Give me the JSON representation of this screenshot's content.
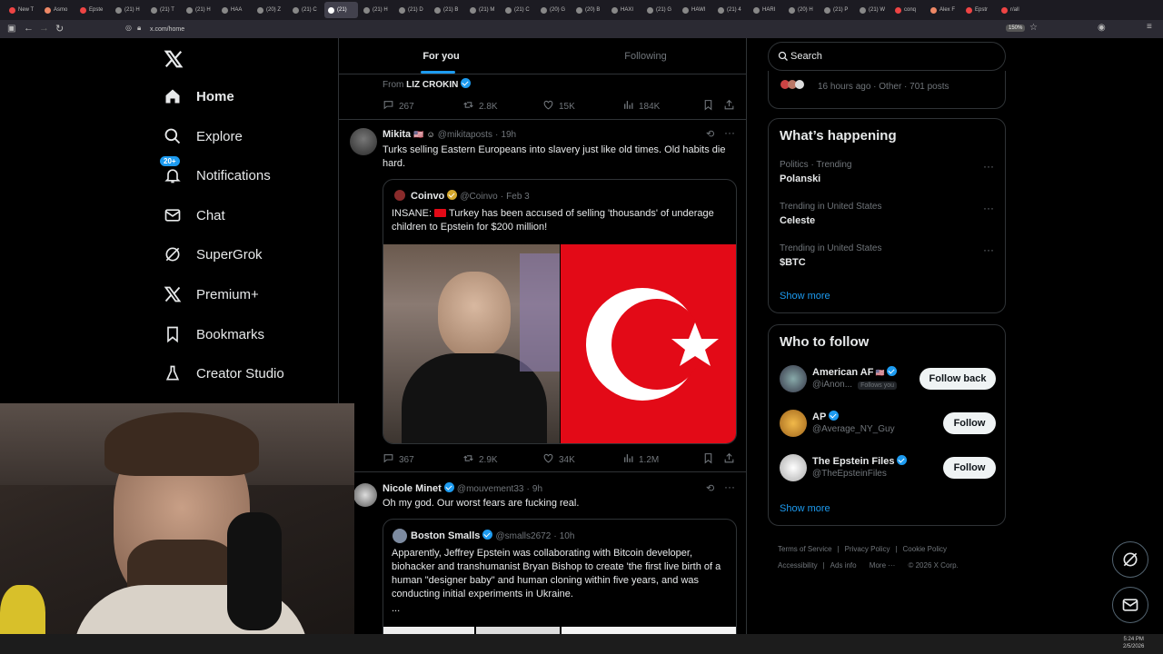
{
  "browser": {
    "tabs": [
      "New T",
      "Asmo",
      "Epste",
      "(21) H",
      "(21) T",
      "(21) H",
      "HAA",
      "(20) Z",
      "(21) C",
      "(21)",
      "(21) H",
      "(21) D",
      "(21) B",
      "(21) M",
      "(21) C",
      "(20) G",
      "(20) B",
      "HAXI",
      "(21) G",
      "HAWI",
      "(21) 4",
      "HARI",
      "(20) H",
      "(21) P",
      "(21) W",
      "conq",
      "Alex F",
      "Epstr",
      "r/all"
    ],
    "url": "x.com/home",
    "zoom": "150%"
  },
  "nav": {
    "items": [
      {
        "label": "Home",
        "icon": "home-icon",
        "bold": true
      },
      {
        "label": "Explore",
        "icon": "search-icon"
      },
      {
        "label": "Notifications",
        "icon": "bell-icon",
        "badge": "20+"
      },
      {
        "label": "Chat",
        "icon": "mail-icon"
      },
      {
        "label": "SuperGrok",
        "icon": "grok-icon"
      },
      {
        "label": "Premium+",
        "icon": "x-logo-icon"
      },
      {
        "label": "Bookmarks",
        "icon": "bookmark-icon"
      },
      {
        "label": "Creator Studio",
        "icon": "flask-icon"
      }
    ]
  },
  "timeline": {
    "tabs": [
      "For you",
      "Following"
    ],
    "prev_post": {
      "from_label": "From",
      "from_name": "LIZ CROKIN",
      "replies": "267",
      "reposts": "2.8K",
      "likes": "15K",
      "views": "184K"
    },
    "post1": {
      "name": "Mikita",
      "handle": "@mikitaposts",
      "time": "19h",
      "text": "Turks selling Eastern Europeans into slavery just like old times. Old habits die hard.",
      "quote": {
        "name": "Coinvo",
        "handle": "@Coinvo",
        "time": "Feb 3",
        "text_prefix": "INSANE:",
        "text": "Turkey has been accused of selling 'thousands' of underage children to Epstein for $200 million!"
      },
      "replies": "367",
      "reposts": "2.9K",
      "likes": "34K",
      "views": "1.2M"
    },
    "post2": {
      "name": "Nicole Minet",
      "handle": "@mouvement33",
      "time": "9h",
      "text": "Oh my god. Our worst fears are fucking real.",
      "quote": {
        "name": "Boston Smalls",
        "handle": "@smalls2672",
        "time": "10h",
        "text": "Apparently, Jeffrey Epstein was collaborating with Bitcoin developer, biohacker and transhumanist Bryan Bishop to create 'the first live birth of a human \"designer baby\" and human cloning within five years, and was conducting initial experiments in Ukraine.",
        "ellipsis": "..."
      }
    }
  },
  "sidebar": {
    "search_placeholder": "Search",
    "live_meta": "16 hours ago · Other · 701 posts",
    "happening": {
      "title": "What’s happening",
      "trends": [
        {
          "meta": "Politics · Trending",
          "name": "Polanski"
        },
        {
          "meta": "Trending in United States",
          "name": "Celeste"
        },
        {
          "meta": "Trending in United States",
          "name": "$BTC"
        }
      ],
      "show_more": "Show more"
    },
    "who_to_follow": {
      "title": "Who to follow",
      "accounts": [
        {
          "name": "American AF",
          "handle": "@iAnon...",
          "follows_you": "Follows you",
          "button": "Follow back"
        },
        {
          "name": "AP",
          "handle": "@Average_NY_Guy",
          "button": "Follow"
        },
        {
          "name": "The Epstein Files",
          "handle": "@TheEpsteinFiles",
          "button": "Follow"
        }
      ],
      "show_more": "Show more"
    },
    "footer": [
      "Terms of Service",
      "Privacy Policy",
      "Cookie Policy",
      "Accessibility",
      "Ads info",
      "More ···",
      "© 2026 X Corp."
    ]
  },
  "taskbar": {
    "time": "5:24 PM",
    "date": "2/5/2026"
  },
  "colors": {
    "accent": "#1d9bf0",
    "border": "#2f3336",
    "muted": "#71767b"
  }
}
